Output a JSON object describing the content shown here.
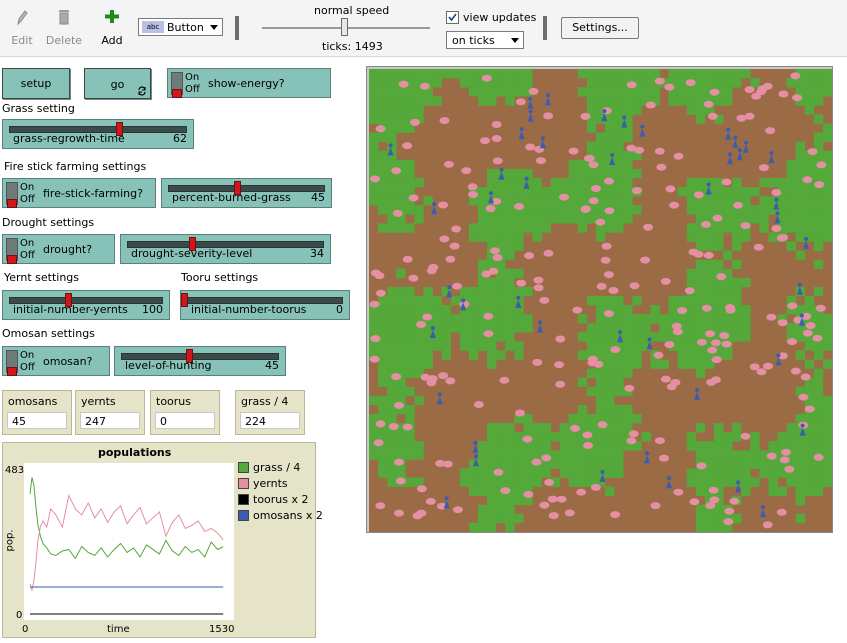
{
  "toolbar": {
    "edit_label": "Edit",
    "delete_label": "Delete",
    "add_label": "Add",
    "widget_type": "Button",
    "speed_label": "normal speed",
    "ticks_label": "ticks: 1493",
    "view_updates_label": "view updates",
    "view_updates_checked": true,
    "update_mode": "on ticks",
    "settings_label": "Settings..."
  },
  "buttons": {
    "setup_label": "setup",
    "go_label": "go"
  },
  "switches": {
    "on_label": "On",
    "off_label": "Off",
    "show_energy": "show-energy?",
    "fire_stick": "fire-stick-farming?",
    "drought": "drought?",
    "omosan": "omosan?"
  },
  "sections": {
    "grass": "Grass setting",
    "fire": "Fire stick farming settings",
    "drought": "Drought settings",
    "yernt": "Yernt settings",
    "tooru": "Tooru settings",
    "omosan": "Omosan settings"
  },
  "sliders": {
    "grass_regrowth": {
      "name": "grass-regrowth-time",
      "value": "62"
    },
    "percent_burned": {
      "name": "percent-burned-grass",
      "value": "45"
    },
    "drought_severity": {
      "name": "drought-severity-level",
      "value": "34"
    },
    "initial_yernts": {
      "name": "initial-number-yernts",
      "value": "100"
    },
    "initial_toorus": {
      "name": "initial-number-toorus",
      "value": "0"
    },
    "hunting": {
      "name": "level-of-hunting",
      "value": "45"
    }
  },
  "monitors": {
    "omosans": {
      "name": "omosans",
      "value": "45"
    },
    "yernts": {
      "name": "yernts",
      "value": "247"
    },
    "toorus": {
      "name": "toorus",
      "value": "0"
    },
    "grass": {
      "name": "grass / 4",
      "value": "224"
    }
  },
  "colors": {
    "widget": "#86c2b8",
    "monitor": "#e5e4c8",
    "soil": "#9b6b45",
    "grass": "#55a83a",
    "yernt": "#e48fa4",
    "omosan": "#3a5db1"
  },
  "chart_data": {
    "type": "line",
    "title": "populations",
    "xlabel": "time",
    "ylabel": "pop.",
    "x_ticks": [
      "0",
      "1530"
    ],
    "y_ticks": [
      "0",
      "483"
    ],
    "xlim": [
      0,
      1530
    ],
    "ylim": [
      0,
      483
    ],
    "series": [
      {
        "name": "grass / 4",
        "color": "#55a83a",
        "x": [
          0,
          15,
          30,
          45,
          60,
          80,
          100,
          130,
          160,
          200,
          250,
          300,
          350,
          400,
          450,
          500,
          550,
          600,
          650,
          700,
          750,
          800,
          850,
          900,
          950,
          1000,
          1050,
          1100,
          1150,
          1200,
          1250,
          1300,
          1350,
          1400,
          1450,
          1493
        ],
        "y": [
          400,
          455,
          430,
          360,
          300,
          260,
          235,
          220,
          200,
          195,
          210,
          215,
          185,
          225,
          205,
          195,
          220,
          190,
          215,
          235,
          205,
          220,
          190,
          230,
          215,
          200,
          245,
          210,
          195,
          225,
          205,
          215,
          190,
          240,
          215,
          224
        ]
      },
      {
        "name": "yernts",
        "color": "#e48fa4",
        "x": [
          0,
          15,
          30,
          45,
          60,
          80,
          100,
          130,
          160,
          200,
          250,
          300,
          350,
          400,
          450,
          500,
          550,
          600,
          650,
          700,
          750,
          800,
          850,
          900,
          950,
          1000,
          1050,
          1100,
          1150,
          1200,
          1250,
          1300,
          1350,
          1400,
          1450,
          1493
        ],
        "y": [
          100,
          80,
          110,
          170,
          240,
          290,
          310,
          290,
          350,
          330,
          290,
          395,
          350,
          330,
          370,
          320,
          350,
          305,
          340,
          360,
          300,
          330,
          355,
          300,
          320,
          340,
          260,
          305,
          330,
          285,
          295,
          310,
          275,
          285,
          270,
          247
        ]
      },
      {
        "name": "toorus x 2",
        "color": "#000000",
        "x": [
          0,
          1493
        ],
        "y": [
          0,
          0
        ]
      },
      {
        "name": "omosans x 2",
        "color": "#3a5db1",
        "x": [
          0,
          20,
          1493
        ],
        "y": [
          90,
          90,
          90
        ]
      }
    ]
  }
}
